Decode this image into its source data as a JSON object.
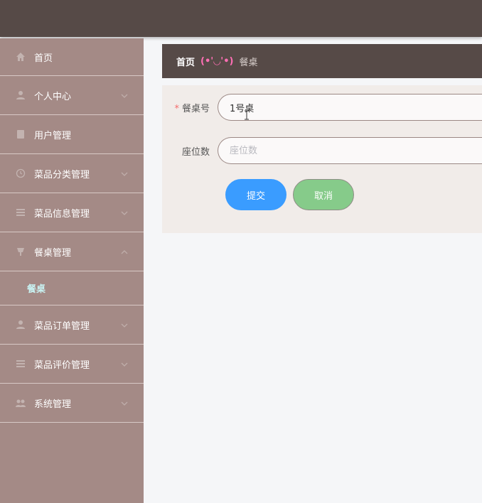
{
  "sidebar": {
    "items": [
      {
        "label": "首页",
        "icon": "home-icon"
      },
      {
        "label": "个人中心",
        "icon": "user-icon"
      },
      {
        "label": "用户管理",
        "icon": "users-icon"
      },
      {
        "label": "菜品分类管理",
        "icon": "category-icon"
      },
      {
        "label": "菜品信息管理",
        "icon": "list-icon"
      },
      {
        "label": "餐桌管理",
        "icon": "table-icon"
      },
      {
        "label": "菜品订单管理",
        "icon": "order-icon"
      },
      {
        "label": "菜品评价管理",
        "icon": "review-icon"
      },
      {
        "label": "系统管理",
        "icon": "system-icon"
      }
    ],
    "submenu_active": "餐桌"
  },
  "breadcrumb": {
    "home": "首页",
    "separator": "(•'◡'•)",
    "current": "餐桌"
  },
  "form": {
    "table_number": {
      "label": "餐桌号",
      "required_mark": "*",
      "value": "1号桌"
    },
    "seats": {
      "label": "座位数",
      "placeholder": "座位数",
      "value": ""
    },
    "submit_label": "提交",
    "cancel_label": "取消"
  },
  "colors": {
    "topbar": "#564a47",
    "sidebar": "#a48a86",
    "submenu_active": "#c8f2f2",
    "breadcrumb_separator": "#ff6fb5",
    "submit": "#3a9cff",
    "cancel": "#86cb8a",
    "required": "#f56c6c"
  }
}
